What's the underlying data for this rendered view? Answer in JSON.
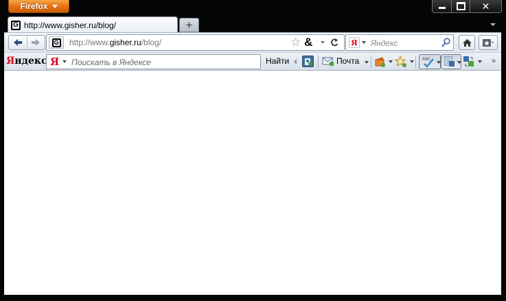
{
  "window": {
    "app_button_label": "Firefox",
    "close_glyph": "✕"
  },
  "tab": {
    "title": "http://www.gisher.ru/blog/",
    "favicon": "G",
    "new_tab_glyph": "+"
  },
  "address_bar": {
    "url_prefix": "http://www.",
    "url_domain": "gisher.ru",
    "url_path": "/blog/",
    "star_glyph": "☆",
    "amp_glyph": "&",
    "reload_glyph": "C"
  },
  "search_bar": {
    "engine_glyph": "Я",
    "placeholder": "Яндекс"
  },
  "yandex_bar": {
    "brand_first": "Я",
    "brand_rest": "ндекс",
    "search_glyph": "Я",
    "search_placeholder": "Поискать в Яндексе",
    "find_label": "Найти",
    "mail_label": "Почта",
    "overflow_glyph": "»"
  },
  "colors": {
    "firefox_orange": "#e4700c",
    "yandex_red": "#e0001b",
    "chrome_frame": "#050505"
  }
}
